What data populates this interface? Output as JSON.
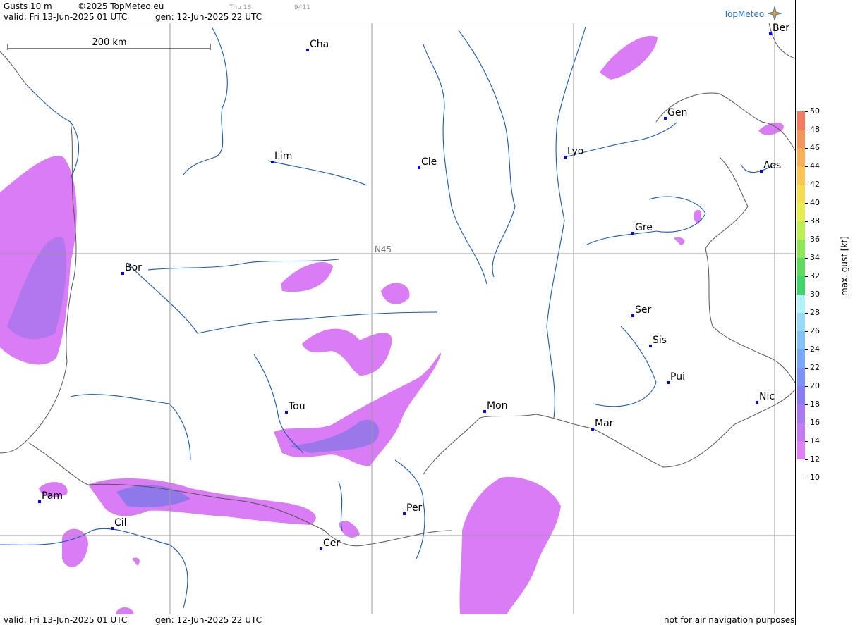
{
  "header": {
    "product": "Gusts 10 m",
    "copyright": "©2025 TopMeteo.eu",
    "valid": "valid:  Fri  13-Jun-2025  01 UTC",
    "gen": "gen: 12-Jun-2025 22 UTC",
    "day_tab": "Thu 18",
    "code": "9411",
    "logo": "TopMeteo"
  },
  "map": {
    "scale_label": "200 km",
    "lat_label": "N45",
    "colors": {
      "gust_main": "#d97cf5",
      "gust_mid": "#c07cf0",
      "gust_dark": "#9a78ea",
      "rivers": "#1b57b8",
      "borders": "#555555",
      "grid": "#999999",
      "city_marker": "#0000ff"
    },
    "cities": [
      "Cha",
      "Ber",
      "Gen",
      "Lim",
      "Cle",
      "Lyo",
      "Aos",
      "Gre",
      "Bor",
      "Ser",
      "Sis",
      "Pui",
      "Tou",
      "Mon",
      "Nic",
      "Mar",
      "Pam",
      "Cil",
      "Per",
      "Cer"
    ]
  },
  "legend": {
    "title": "max. gust  [kt]",
    "ticks": [
      "50",
      "48",
      "46",
      "44",
      "42",
      "40",
      "38",
      "36",
      "34",
      "32",
      "30",
      "28",
      "26",
      "24",
      "22",
      "20",
      "18",
      "16",
      "14",
      "12",
      "10"
    ],
    "colors": [
      "#f47a62",
      "#f6965c",
      "#f9ae58",
      "#fbc454",
      "#f8dc4f",
      "#e6ee4f",
      "#bdee53",
      "#8fe657",
      "#5fdc5e",
      "#3ed569",
      "#b2f2f8",
      "#98daf8",
      "#84c2fa",
      "#78a8fb",
      "#7c92f8",
      "#8a7cf3",
      "#a77af0",
      "#c27bf0",
      "#df80f5"
    ]
  },
  "footer": {
    "valid": "valid:  Fri  13-Jun-2025  01 UTC",
    "gen": "gen: 12-Jun-2025 22 UTC",
    "note": "not for air navigation purposes"
  }
}
